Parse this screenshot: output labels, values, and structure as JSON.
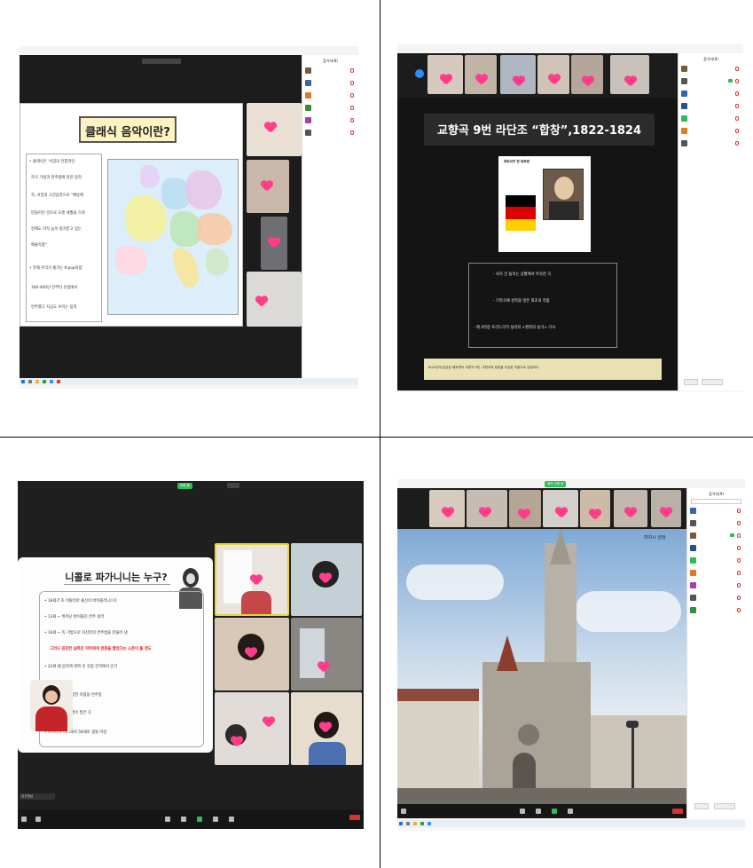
{
  "q1": {
    "slide_title": "클래식 음악이란?",
    "bullets": [
      "• 클래식은 '서양의 전통적인",
      "작곡 기법과 연주법에 의한 음악.",
      "즉, 서양의 고전음악으로 \"예날에",
      "만들어진 것으로 오랜 세월을 거쳐",
      "현재도 아직 높이 평가받고 있는",
      "예술작품\"",
      "• 현재 우리가 즐기는 K-pop처럼",
      "300-400년 전부터 유럽에서",
      "연주했고 지금도 쓰이는 음악"
    ],
    "panel_title": "참가자(8)"
  },
  "q2": {
    "slide_title": "교향곡 9번 라단조 “합창”,1822-1824",
    "composer_label": "루트비히 판 베토벤",
    "bullets": [
      "- 귀가 안 들리는 상황에서 작곡한 곡",
      "- 기악곡에 성악을 넣은 최초의 작품",
      "- 제 4악장 프리드리히 실러의 <환희의 송가> 가사"
    ],
    "footer_text": "1824년에 완성된 베토벤의 교향곡 9번. 교향곡에 합창을 도입한 작품으로 유명하다.",
    "panel_title": "참가자(8)"
  },
  "q3": {
    "slide_title": "니콜로 파가니니는 누구?",
    "bullets": [
      "• 18세기 초 이탈리아 출신의 바이올리니스트",
      "• 13세 ~ 뛰어난 바이올린 연주 실력",
      "• 16세 ~ 독 기법으로 자신만의 연주법을 만들어 냄",
      "그러나 굉장한 실력은 악마에게 영혼을 팔았다는 소문이 돌 정도",
      "• 22세 때 음악계 데뷔 후 유럽 전역에서 인기",
      "• 소문이 생겨 다양한 작품을 연주함",
      "• 어려운 연주 기법이 많은 곡",
      "• 파가니니 니스에서 58세로 생을 마감"
    ],
    "recording_chip": "녹화 중",
    "name_tag": "김선생님"
  },
  "q4": {
    "photo_caption": "마차시 성당",
    "meeting_chip": "회의 진행 중",
    "panel_title": "참가자(9)"
  },
  "colors": {
    "accent_pink": "#ff3d8b",
    "slide_bar": "#2b2b2b",
    "zoom_green": "#2ebd59",
    "end_red": "#d63333"
  }
}
